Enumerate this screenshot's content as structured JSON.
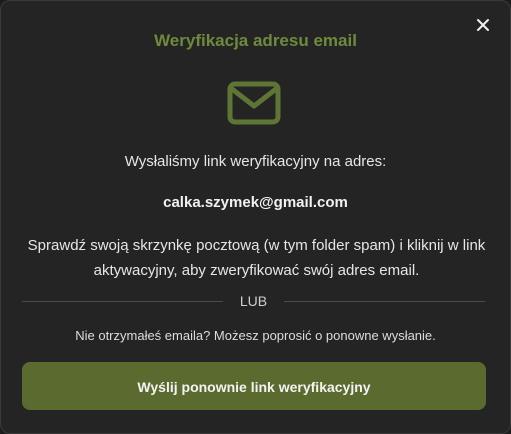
{
  "modal": {
    "title": "Weryfikacja adresu email",
    "intro_text": "Wysłaliśmy link weryfikacyjny na adres:",
    "email": "calka.szymek@gmail.com",
    "instructions": "Sprawdź swoją skrzynkę pocztową (w tym folder spam) i kliknij w link aktywacyjny, aby zweryfikować swój adres email.",
    "divider_label": "LUB",
    "resend_note": "Nie otrzymałeś emaila? Możesz poprosić o ponowne wysłanie.",
    "resend_button_label": "Wyślij ponownie link weryfikacyjny",
    "close_icon": "close-icon",
    "mail_icon": "mail-icon"
  },
  "colors": {
    "accent": "#6f8a3d",
    "button_bg": "#5b6b2f",
    "background": "#242424",
    "text": "#e6e6e6"
  }
}
